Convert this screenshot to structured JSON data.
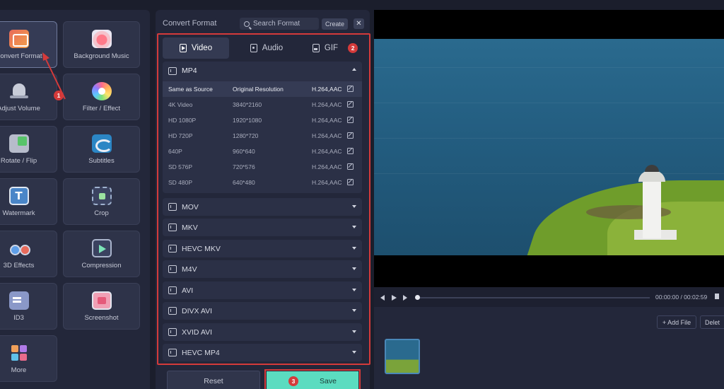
{
  "tools": [
    {
      "label": "Convert Format",
      "icon": "convert-format-icon",
      "active": true
    },
    {
      "label": "Background Music",
      "icon": "background-music-icon"
    },
    {
      "label": "Adjust Volume",
      "icon": "adjust-volume-icon"
    },
    {
      "label": "Filter / Effect",
      "icon": "filter-effect-icon"
    },
    {
      "label": "Rotate / Flip",
      "icon": "rotate-flip-icon"
    },
    {
      "label": "Subtitles",
      "icon": "subtitles-icon"
    },
    {
      "label": "Watermark",
      "icon": "watermark-icon"
    },
    {
      "label": "Crop",
      "icon": "crop-icon"
    },
    {
      "label": "3D Effects",
      "icon": "3d-effects-icon"
    },
    {
      "label": "Compression",
      "icon": "compression-icon"
    },
    {
      "label": "ID3",
      "icon": "id3-icon"
    },
    {
      "label": "Screenshot",
      "icon": "screenshot-icon"
    },
    {
      "label": "More",
      "icon": "more-icon"
    }
  ],
  "panel": {
    "title": "Convert Format",
    "search_placeholder": "Search Format",
    "create_label": "Create",
    "close_label": "✕"
  },
  "tabs": [
    {
      "label": "Video",
      "active": true
    },
    {
      "label": "Audio"
    },
    {
      "label": "GIF"
    }
  ],
  "mp4": {
    "name": "MP4",
    "rows": [
      {
        "name": "Same as Source",
        "resolution": "Original Resolution",
        "codec": "H.264,AAC",
        "selected": true
      },
      {
        "name": "4K Video",
        "resolution": "3840*2160",
        "codec": "H.264,AAC"
      },
      {
        "name": "HD 1080P",
        "resolution": "1920*1080",
        "codec": "H.264,AAC"
      },
      {
        "name": "HD 720P",
        "resolution": "1280*720",
        "codec": "H.264,AAC"
      },
      {
        "name": "640P",
        "resolution": "960*640",
        "codec": "H.264,AAC"
      },
      {
        "name": "SD 576P",
        "resolution": "720*576",
        "codec": "H.264,AAC"
      },
      {
        "name": "SD 480P",
        "resolution": "640*480",
        "codec": "H.264,AAC"
      }
    ]
  },
  "formats": [
    "MOV",
    "MKV",
    "HEVC MKV",
    "M4V",
    "AVI",
    "DIVX AVI",
    "XVID AVI",
    "HEVC MP4"
  ],
  "buttons": {
    "reset": "Reset",
    "save": "Save"
  },
  "annotations": {
    "one": "1",
    "two": "2",
    "three": "3"
  },
  "player": {
    "time": "00:00:00 / 00:02:59"
  },
  "files": {
    "add_file": "+ Add File",
    "delete": "Delet"
  },
  "colors": {
    "accent": "#5bdcc0",
    "highlight": "#d43a3a"
  }
}
